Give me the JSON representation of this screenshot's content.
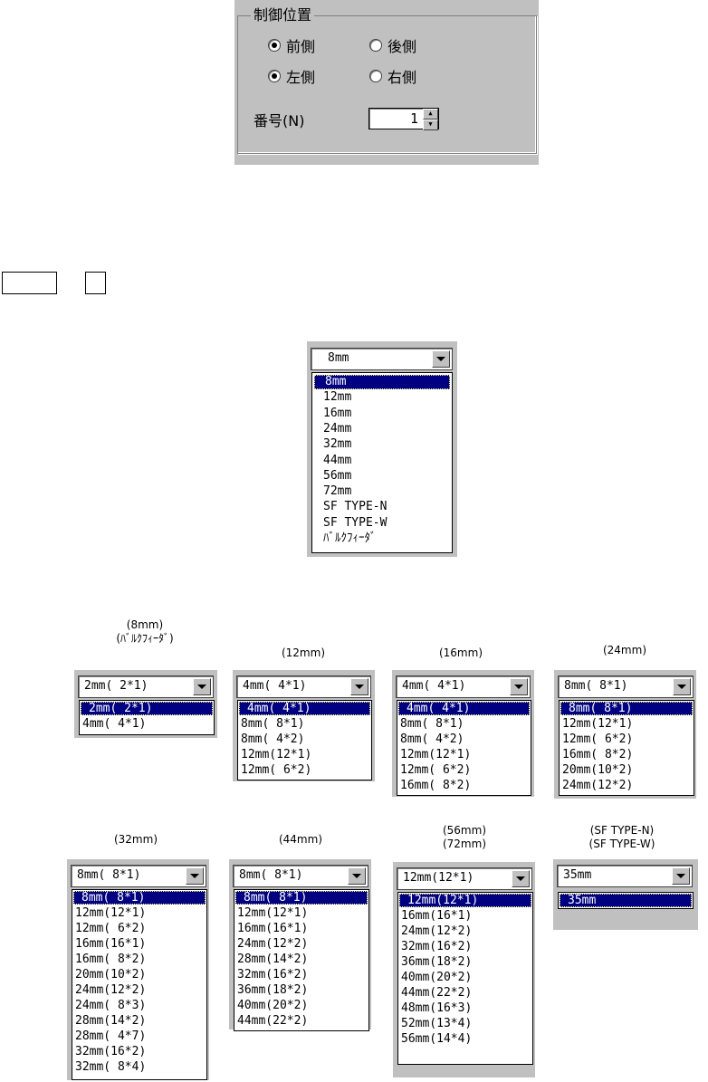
{
  "control_position": {
    "legend": "制御位置",
    "front": "前側",
    "rear": "後側",
    "left": "左側",
    "right": "右側",
    "front_checked": true,
    "left_checked": true,
    "number_label": "番号(N)",
    "number_value": "1"
  },
  "width_combo": {
    "value": "8mm",
    "items": [
      "8mm",
      "12mm",
      "16mm",
      "24mm",
      "32mm",
      "44mm",
      "56mm",
      "72mm",
      "SF TYPE-N",
      "SF TYPE-W",
      "ﾊﾞﾙｸﾌｨｰﾀﾞ"
    ],
    "selected_index": 0
  },
  "pitch_combos": [
    {
      "caption": "(8mm)\n(ﾊﾞﾙｸﾌｨｰﾀﾞ)",
      "value": "2mm( 2*1)",
      "items": [
        "2mm( 2*1)",
        "4mm( 4*1)"
      ]
    },
    {
      "caption": "(12mm)",
      "value": "4mm( 4*1)",
      "items": [
        "4mm( 4*1)",
        "8mm( 8*1)",
        "8mm( 4*2)",
        "12mm(12*1)",
        "12mm( 6*2)"
      ]
    },
    {
      "caption": "(16mm)",
      "value": "4mm( 4*1)",
      "items": [
        "4mm( 4*1)",
        "8mm( 8*1)",
        "8mm( 4*2)",
        "12mm(12*1)",
        "12mm( 6*2)",
        "16mm( 8*2)"
      ]
    },
    {
      "caption": "(24mm)",
      "value": "8mm( 8*1)",
      "items": [
        "8mm( 8*1)",
        "12mm(12*1)",
        "12mm( 6*2)",
        "16mm( 8*2)",
        "20mm(10*2)",
        "24mm(12*2)"
      ]
    },
    {
      "caption": "(32mm)",
      "value": "8mm( 8*1)",
      "items": [
        "8mm( 8*1)",
        "12mm(12*1)",
        "12mm( 6*2)",
        "16mm(16*1)",
        "16mm( 8*2)",
        "20mm(10*2)",
        "24mm(12*2)",
        "24mm( 8*3)",
        "28mm(14*2)",
        "28mm( 4*7)",
        "32mm(16*2)",
        "32mm( 8*4)"
      ]
    },
    {
      "caption": "(44mm)",
      "value": "8mm( 8*1)",
      "items": [
        "8mm( 8*1)",
        "12mm(12*1)",
        "16mm(16*1)",
        "24mm(12*2)",
        "28mm(14*2)",
        "32mm(16*2)",
        "36mm(18*2)",
        "40mm(20*2)",
        "44mm(22*2)"
      ]
    },
    {
      "caption": "(56mm)\n(72mm)",
      "value": "12mm(12*1)",
      "items": [
        "12mm(12*1)",
        "16mm(16*1)",
        "24mm(12*2)",
        "32mm(16*2)",
        "36mm(18*2)",
        "40mm(20*2)",
        "44mm(22*2)",
        "48mm(16*3)",
        "52mm(13*4)",
        "56mm(14*4)"
      ]
    },
    {
      "caption": "(SF TYPE-N)\n(SF TYPE-W)",
      "value": "35mm",
      "items": [
        "35mm"
      ]
    }
  ]
}
